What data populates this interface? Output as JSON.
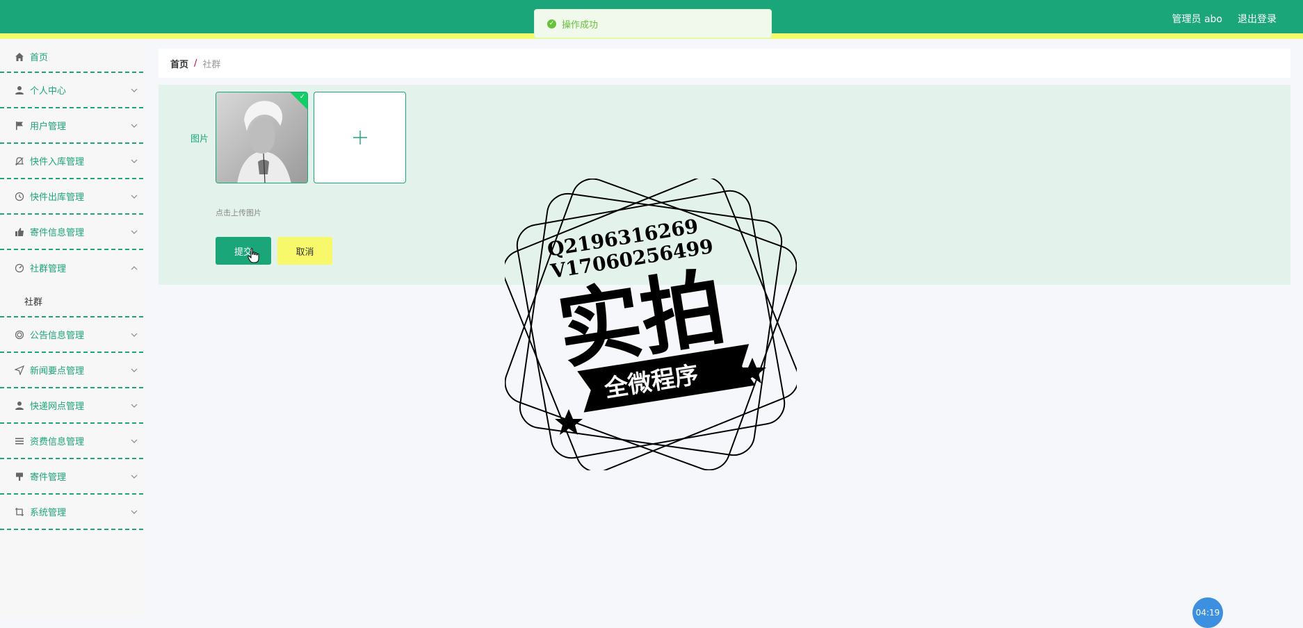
{
  "header": {
    "admin_label": "管理员 abo",
    "logout_label": "退出登录"
  },
  "toast": {
    "message": "操作成功"
  },
  "sidebar": {
    "items": [
      {
        "label": "首页",
        "icon": "home-icon"
      },
      {
        "label": "个人中心",
        "icon": "user-icon"
      },
      {
        "label": "用户管理",
        "icon": "flag-icon"
      },
      {
        "label": "快件入库管理",
        "icon": "bell-icon"
      },
      {
        "label": "快件出库管理",
        "icon": "clock-icon"
      },
      {
        "label": "寄件信息管理",
        "icon": "thumb-icon"
      },
      {
        "label": "社群管理",
        "icon": "dashboard-icon"
      },
      {
        "label": "公告信息管理",
        "icon": "circle-icon"
      },
      {
        "label": "新闻要点管理",
        "icon": "send-icon"
      },
      {
        "label": "快递网点管理",
        "icon": "user-icon"
      },
      {
        "label": "资费信息管理",
        "icon": "menu-icon"
      },
      {
        "label": "寄件管理",
        "icon": "brush-icon"
      },
      {
        "label": "系统管理",
        "icon": "crop-icon"
      }
    ],
    "submenu_label": "社群"
  },
  "breadcrumb": {
    "home": "首页",
    "separator": "/",
    "current": "社群"
  },
  "form": {
    "image_label": "图片",
    "upload_hint": "点击上传图片",
    "submit_label": "提交",
    "cancel_label": "取消"
  },
  "watermark": {
    "line1": "Q2196316269",
    "line2": "V17060256499",
    "big_text": "实拍",
    "banner_text": "全微程序"
  },
  "clock": {
    "time": "04:19"
  },
  "colors": {
    "primary": "#1ba67a",
    "accent_yellow": "#f2fb6a",
    "toast_green": "#67c23a"
  }
}
